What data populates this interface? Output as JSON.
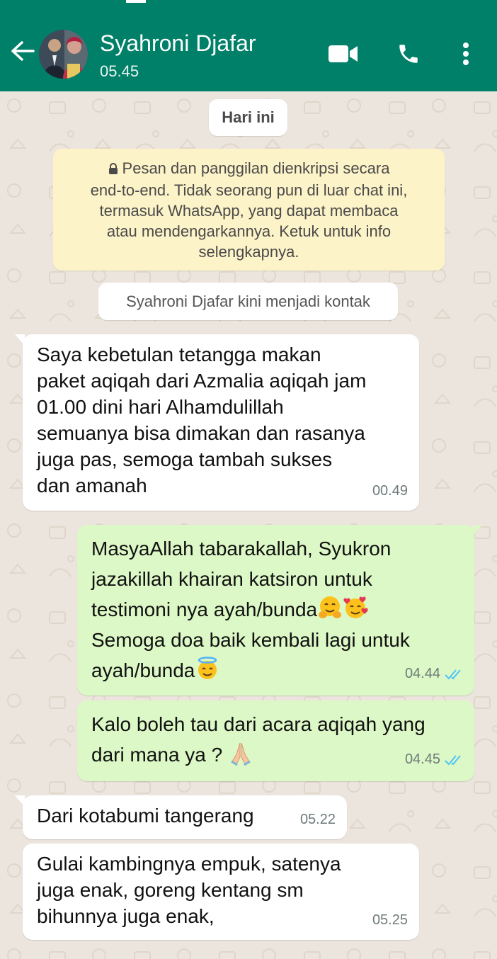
{
  "header": {
    "contact_name": "Syahroni Djafar",
    "subtitle": "05.45",
    "icons": [
      "back-arrow-icon",
      "video-call-icon",
      "phone-icon",
      "more-vert-icon"
    ]
  },
  "colors": {
    "header": "#008069",
    "incoming": "#ffffff",
    "outgoing": "#dcf8c6",
    "encryption": "#fdf3c8",
    "ticks": "#4fc3f7"
  },
  "chat": {
    "date_chip": "Hari ini",
    "encryption_notice": "Pesan dan panggilan dienkripsi secara\nend-to-end. Tidak seorang pun di luar chat ini,\ntermasuk WhatsApp, yang dapat membaca\natau mendengarkannya. Ketuk untuk info\nselengkapnya.",
    "contact_notice": "Syahroni Djafar kini menjadi kontak",
    "messages": [
      {
        "direction": "in",
        "text": "Saya kebetulan tetangga makan\npaket aqiqah dari Azmalia aqiqah jam\n01.00 dini hari Alhamdulillah\nsemuanya bisa dimakan dan rasanya\njuga pas, semoga tambah sukses\ndan amanah",
        "time": "00.49"
      },
      {
        "direction": "out",
        "line1": "MasyaAllah tabarakallah, Syukron",
        "line2": "jazakillah khairan katsiron untuk",
        "line3": "testimoni nya ayah/bunda",
        "line4": "Semoga doa baik kembali lagi untuk",
        "line5": "ayah/bunda",
        "emojis": [
          "hugging-face-emoji",
          "smiling-face-with-hearts-emoji",
          "smiling-face-with-halo-emoji"
        ],
        "time": "04.44",
        "status": "read"
      },
      {
        "direction": "out",
        "line1": "Kalo boleh tau dari acara aqiqah yang",
        "line2": "dari mana ya ?",
        "emojis": [
          "folded-hands-emoji"
        ],
        "time": "04.45",
        "status": "read"
      },
      {
        "direction": "in",
        "text": "Dari kotabumi tangerang",
        "time": "05.22"
      },
      {
        "direction": "in",
        "text": "Gulai kambingnya empuk,  satenya\njuga enak, goreng kentang sm\nbihunnya juga enak,",
        "time": "05.25"
      }
    ]
  }
}
